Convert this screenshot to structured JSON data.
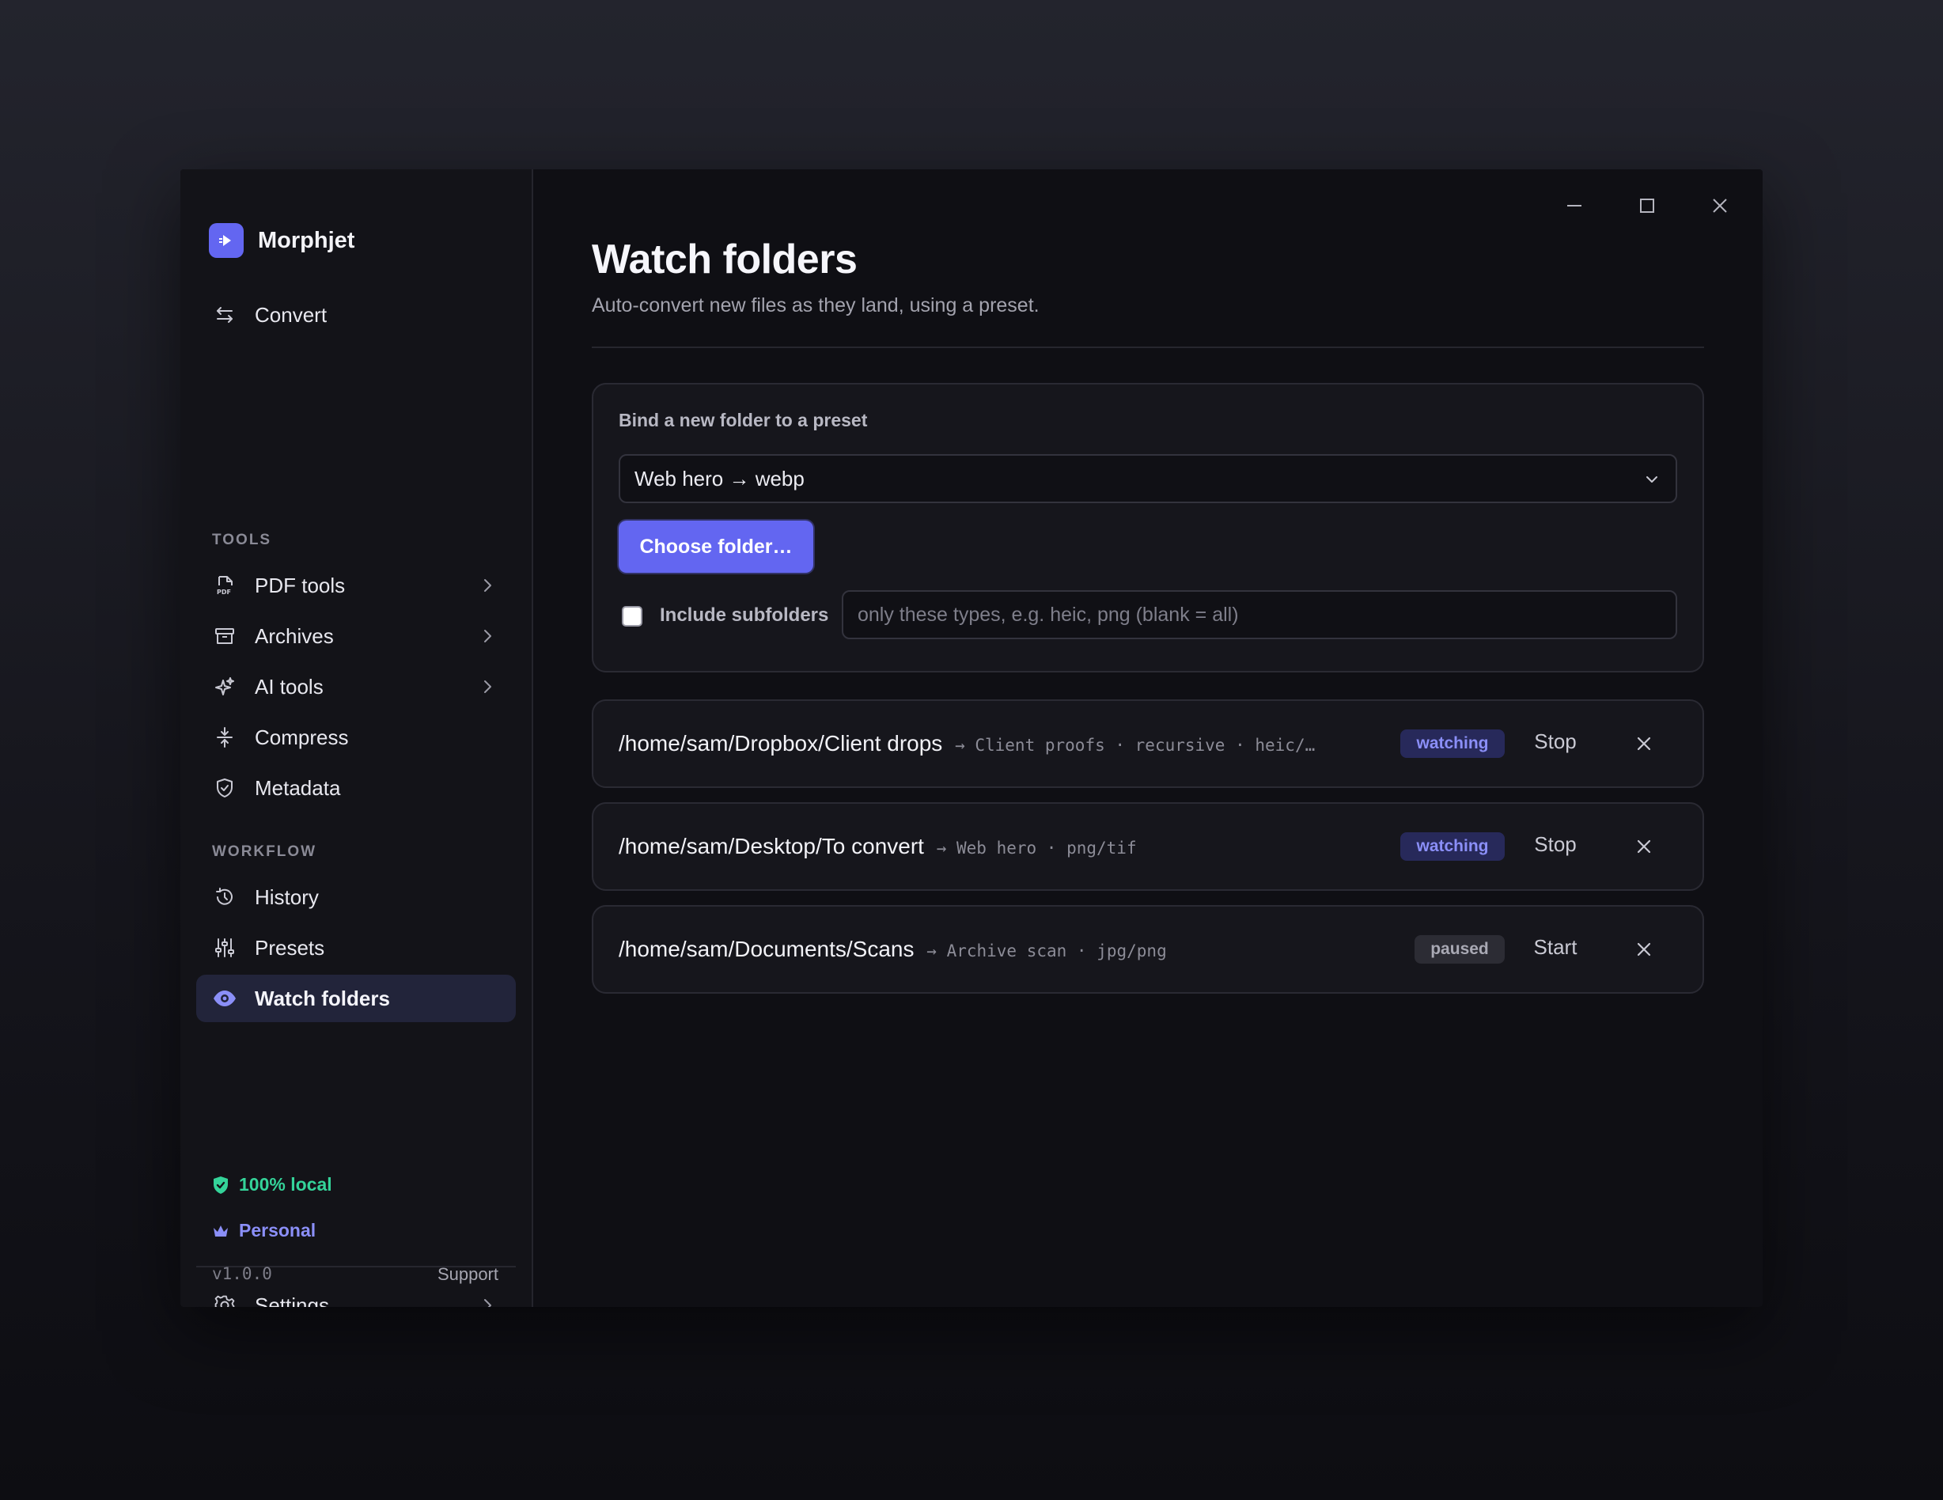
{
  "app": {
    "name": "Morphjet"
  },
  "sidebar": {
    "primary": {
      "label": "Convert",
      "icon": "arrows-swap-icon"
    },
    "tools_heading": "TOOLS",
    "tools": [
      {
        "label": "PDF tools",
        "icon": "pdf-file-icon",
        "submenu": true
      },
      {
        "label": "Archives",
        "icon": "archive-box-icon",
        "submenu": true
      },
      {
        "label": "AI tools",
        "icon": "sparkles-icon",
        "submenu": true
      },
      {
        "label": "Compress",
        "icon": "compress-icon",
        "submenu": false
      },
      {
        "label": "Metadata",
        "icon": "shield-icon",
        "submenu": false
      }
    ],
    "workflow_heading": "WORKFLOW",
    "workflow": [
      {
        "label": "History",
        "icon": "history-icon"
      },
      {
        "label": "Presets",
        "icon": "sliders-icon"
      },
      {
        "label": "Watch folders",
        "icon": "eye-icon",
        "active": true
      }
    ],
    "settings": {
      "label": "Settings",
      "icon": "gear-icon"
    },
    "local_badge": "100% local",
    "plan_badge": "Personal",
    "version": "v1.0.0",
    "support": "Support"
  },
  "main": {
    "title": "Watch folders",
    "subtitle": "Auto-convert new files as they land, using a preset.",
    "bind": {
      "title": "Bind a new folder to a preset",
      "preset_selected": "Web hero → webp",
      "choose_button": "Choose folder…",
      "include_subfolders_label": "Include subfolders",
      "include_subfolders_checked": false,
      "types_placeholder": "only these types, e.g. heic, png (blank = all)",
      "types_value": ""
    },
    "rows": [
      {
        "path": "/home/sam/Dropbox/Client drops",
        "meta": "→ Client proofs · recursive · heic/…",
        "status": "watching",
        "action": "Stop"
      },
      {
        "path": "/home/sam/Desktop/To convert",
        "meta": "→ Web hero · png/tif",
        "status": "watching",
        "action": "Stop"
      },
      {
        "path": "/home/sam/Documents/Scans",
        "meta": "→ Archive scan · jpg/png",
        "status": "paused",
        "action": "Start"
      }
    ]
  },
  "colors": {
    "accent": "#6366f1",
    "local_green": "#34d399",
    "plan_purple": "#8b8ff8"
  }
}
